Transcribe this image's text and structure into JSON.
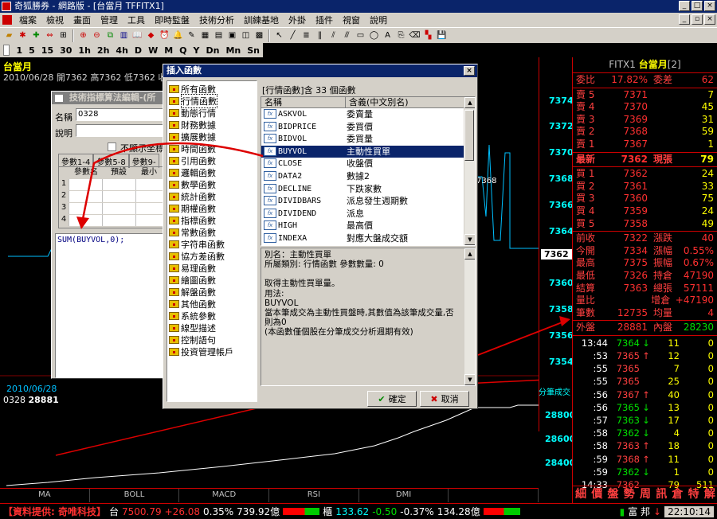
{
  "window": {
    "title": "奇狐勝券 - 網路版 - [台當月 TFFITX1]"
  },
  "menu": [
    "檔案",
    "檢視",
    "畫面",
    "管理",
    "工具",
    "即時監盤",
    "技術分析",
    "訓練基地",
    "外掛",
    "插件",
    "視窗",
    "說明"
  ],
  "periods": [
    "1",
    "5",
    "15",
    "30",
    "1h",
    "2h",
    "4h",
    "D",
    "W",
    "M",
    "Q",
    "Y",
    "Dn",
    "Mn",
    "Sn"
  ],
  "chart": {
    "title": "台當月",
    "info": "2010/06/28  開7362  高7362  低7362  收",
    "price_ticks": [
      "7374",
      "7372",
      "7370",
      "7368",
      "7366",
      "7364",
      "7362",
      "7360",
      "7358",
      "7356",
      "7354"
    ],
    "current_price_marker": "7362",
    "chart_inline_label": "7368",
    "vol_title": "分筆成交",
    "vol_ticks": [
      "28800",
      "28600",
      "28400"
    ],
    "vol_date": "2010/06/28",
    "vol_code": "0328",
    "vol_value": "28881",
    "tabs": [
      "MA",
      "BOLL",
      "MACD",
      "RSI",
      "DMI"
    ]
  },
  "quote": {
    "symbol": "FITX1",
    "name": "台當月",
    "name_suffix": "[2]",
    "ratio_label": "委比",
    "ratio_value": "17.82%",
    "diff_label": "委差",
    "diff_value": "62",
    "asks": [
      {
        "label": "賣 5",
        "price": "7371",
        "vol": "7"
      },
      {
        "label": "賣 4",
        "price": "7370",
        "vol": "45"
      },
      {
        "label": "賣 3",
        "price": "7369",
        "vol": "31"
      },
      {
        "label": "賣 2",
        "price": "7368",
        "vol": "59"
      },
      {
        "label": "賣 1",
        "price": "7367",
        "vol": "1"
      }
    ],
    "last": {
      "label": "最新",
      "price": "7362",
      "lbl2": "現張",
      "vol": "79"
    },
    "bids": [
      {
        "label": "買 1",
        "price": "7362",
        "vol": "24"
      },
      {
        "label": "買 2",
        "price": "7361",
        "vol": "33"
      },
      {
        "label": "買 3",
        "price": "7360",
        "vol": "75"
      },
      {
        "label": "買 4",
        "price": "7359",
        "vol": "24"
      },
      {
        "label": "買 5",
        "price": "7358",
        "vol": "49"
      }
    ],
    "stats": [
      {
        "l1": "前收",
        "v1": "7322",
        "l2": "漲跌",
        "v2": "40"
      },
      {
        "l1": "今開",
        "v1": "7334",
        "l2": "漲幅",
        "v2": "0.55%"
      },
      {
        "l1": "最高",
        "v1": "7375",
        "l2": "振幅",
        "v2": "0.67%"
      },
      {
        "l1": "最低",
        "v1": "7326",
        "l2": "持倉",
        "v2": "47190"
      },
      {
        "l1": "結算",
        "v1": "7363",
        "l2": "總張",
        "v2": "57111"
      },
      {
        "l1": "量比",
        "v1": "",
        "l2": "增倉",
        "v2": "+47190"
      },
      {
        "l1": "筆數",
        "v1": "12735",
        "l2": "均量",
        "v2": "4"
      }
    ],
    "outer": {
      "l1": "外盤",
      "v1": "28881",
      "l2": "內盤",
      "v2": "28230"
    },
    "ticks": [
      {
        "t": "13:44",
        "p": "7364",
        "a": "↓",
        "v": "11",
        "z": "0"
      },
      {
        "t": ":53",
        "p": "7365",
        "a": "↑",
        "v": "12",
        "z": "0"
      },
      {
        "t": ":55",
        "p": "7365",
        "a": "",
        "v": "7",
        "z": "0"
      },
      {
        "t": ":55",
        "p": "7365",
        "a": "",
        "v": "25",
        "z": "0"
      },
      {
        "t": ":56",
        "p": "7367",
        "a": "↑",
        "v": "40",
        "z": "0"
      },
      {
        "t": ":56",
        "p": "7365",
        "a": "↓",
        "v": "13",
        "z": "0"
      },
      {
        "t": ":57",
        "p": "7363",
        "a": "↓",
        "v": "17",
        "z": "0"
      },
      {
        "t": ":58",
        "p": "7362",
        "a": "↓",
        "v": "4",
        "z": "0"
      },
      {
        "t": ":58",
        "p": "7363",
        "a": "↑",
        "v": "18",
        "z": "0"
      },
      {
        "t": ":59",
        "p": "7368",
        "a": "↑",
        "v": "11",
        "z": "0"
      },
      {
        "t": ":59",
        "p": "7362",
        "a": "↓",
        "v": "1",
        "z": "0"
      },
      {
        "t": "14:33",
        "p": "7362",
        "a": "",
        "v": "79",
        "z": "511"
      }
    ],
    "tabs": [
      "細",
      "價",
      "盤",
      "勢",
      "周",
      "訊",
      "倉",
      "特",
      "解"
    ]
  },
  "status": {
    "provider": "【資料提供: 奇唯科技】",
    "idx1_name": "台",
    "idx1_val": "7500.79",
    "idx1_chg": "+26.08",
    "idx1_pct": "0.35%",
    "idx1_amt": "739.92億",
    "idx2_name": "櫃",
    "idx2_val": "133.62",
    "idx2_chg": "-0.50",
    "idx2_pct": "-0.37%",
    "idx2_amt": "134.28億",
    "broker": "富 邦",
    "time": "22:10:14"
  },
  "editor": {
    "title": "技術指標算法編輯-(所屬...",
    "name_label": "名稱",
    "name_value": "0328",
    "desc_label": "說明",
    "hide_label": "不顯示坐標",
    "tabs": [
      "參數1-4",
      "參數5-8",
      "參數9-"
    ],
    "param_headers": [
      "參數名",
      "預設",
      "最小"
    ],
    "rows": [
      "1",
      "2",
      "3",
      "4"
    ],
    "formula": "SUM(BUYVOL,0);"
  },
  "dialog": {
    "title": "插入函數",
    "categories": [
      "所有函數",
      "行情函數",
      "動態行情",
      "財務數據",
      "擴展數據",
      "時間函數",
      "引用函數",
      "邏輯函數",
      "數學函數",
      "統計函數",
      "期權函數",
      "指標函數",
      "常數函數",
      "字符串函數",
      "協方差函數",
      "易理函數",
      "繪圖函數",
      "解盤函數",
      "其他函數",
      "系統參數",
      "線型描述",
      "控制語句",
      "投資管理帳戶"
    ],
    "summary": "[行情函數]含 33 個函數",
    "col_name": "名稱",
    "col_desc": "含義(中文別名)",
    "functions": [
      {
        "n": "ASKVOL",
        "d": "委賣量"
      },
      {
        "n": "BIDPRICE",
        "d": "委買價"
      },
      {
        "n": "BIDVOL",
        "d": "委買量"
      },
      {
        "n": "BUYVOL",
        "d": "主動性買單"
      },
      {
        "n": "CLOSE",
        "d": "收盤價"
      },
      {
        "n": "DATA2",
        "d": "數據2"
      },
      {
        "n": "DECLINE",
        "d": "下跌家數"
      },
      {
        "n": "DIVIDBARS",
        "d": "派息發生週期數"
      },
      {
        "n": "DIVIDEND",
        "d": "派息"
      },
      {
        "n": "HIGH",
        "d": "最高價"
      },
      {
        "n": "INDEXA",
        "d": "對應大盤成交額"
      }
    ],
    "selected_index": 3,
    "desc_lines": [
      "別名：主動性買單",
      "所屬類別: 行情函數  參數數量: 0",
      "",
      "取得主動性買單量。",
      "用法:",
      "BUYVOL",
      "當本筆成交為主動性買盤時,其數值為該筆成交量,否",
      "則為0",
      "(本函數僅個股在分筆成交分析週期有效)"
    ],
    "ok": "確定",
    "cancel": "取消"
  }
}
